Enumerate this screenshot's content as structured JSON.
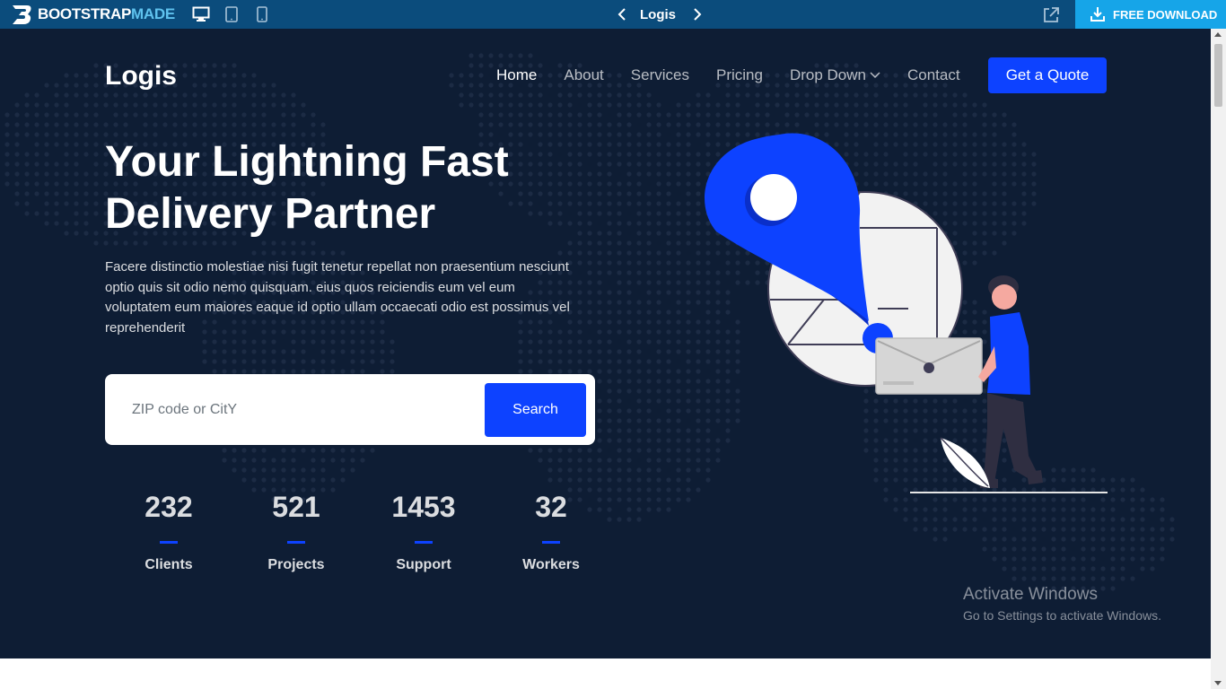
{
  "topbar": {
    "brand_main": "BOOTSTRAP",
    "brand_accent": "MADE",
    "template_title": "Logis",
    "free_download": "FREE DOWNLOAD",
    "devices": [
      "desktop-icon",
      "tablet-icon",
      "mobile-icon"
    ],
    "colors": {
      "bar": "#0b4c7c",
      "download": "#16a5e8",
      "accent": "#5fc2ee"
    }
  },
  "header": {
    "logo": "Logis",
    "nav": [
      "Home",
      "About",
      "Services",
      "Pricing",
      "Drop Down",
      "Contact"
    ],
    "active_nav": "Home",
    "cta": "Get a Quote"
  },
  "hero": {
    "headline": "Your Lightning Fast Delivery Partner",
    "lead": "Facere distinctio molestiae nisi fugit tenetur repellat non praesentium nesciunt optio quis sit odio nemo quisquam. eius quos reiciendis eum vel eum voluptatem eum maiores eaque id optio ullam occaecati odio est possimus vel reprehenderit",
    "search": {
      "placeholder": "ZIP code or CitY",
      "button": "Search"
    },
    "stats": [
      {
        "value": "232",
        "label": "Clients"
      },
      {
        "value": "521",
        "label": "Projects"
      },
      {
        "value": "1453",
        "label": "Support"
      },
      {
        "value": "32",
        "label": "Workers"
      }
    ],
    "colors": {
      "background": "#0e1d34",
      "accent": "#0d42ff"
    }
  },
  "watermark": {
    "title": "Activate Windows",
    "subtitle": "Go to Settings to activate Windows."
  }
}
